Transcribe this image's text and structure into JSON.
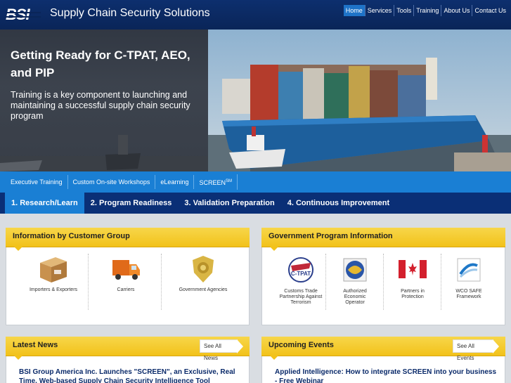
{
  "header": {
    "logo": "BSI",
    "title": "Supply Chain Security Solutions",
    "nav": [
      {
        "label": "Home",
        "active": true
      },
      {
        "label": "Services"
      },
      {
        "label": "Tools"
      },
      {
        "label": "Training"
      },
      {
        "label": "About Us"
      },
      {
        "label": "Contact Us"
      }
    ]
  },
  "hero": {
    "title": "Getting Ready for C-TPAT, AEO, and PIP",
    "subtitle": "Training is a key component to launching and maintaining a successful supply chain security program"
  },
  "program_nav": {
    "items": [
      "Executive Training",
      "Custom On-site Workshops",
      "eLearning",
      "SCREEN"
    ],
    "screen_mark": "SM"
  },
  "steps": [
    {
      "label": "1. Research/Learn",
      "active": true
    },
    {
      "label": "2. Program Readiness"
    },
    {
      "label": "3. Validation Preparation"
    },
    {
      "label": "4. Continuous Improvement"
    }
  ],
  "customer_group": {
    "title": "Information by Customer Group",
    "items": [
      {
        "label": "Importers & Exporters",
        "icon": "package-box-icon"
      },
      {
        "label": "Carriers",
        "icon": "truck-icon"
      },
      {
        "label": "Government Agencies",
        "icon": "badge-icon"
      }
    ]
  },
  "gov_programs": {
    "title": "Government Program Information",
    "items": [
      {
        "label": "Customs Trade Partnership Against Terrorism",
        "lines": [
          "Customs Trade",
          "Partnership Against",
          "Terrorism"
        ],
        "icon": "ctpat-icon"
      },
      {
        "label": "Authorized Economic Operator",
        "lines": [
          "Authorized",
          "Economic",
          "Operator"
        ],
        "icon": "aeo-icon"
      },
      {
        "label": "Partners in Protection",
        "lines": [
          "Partners in",
          "Protection"
        ],
        "icon": "canada-flag-icon"
      },
      {
        "label": "WCO SAFE Framework",
        "lines": [
          "WCO SAFE",
          "Framework"
        ],
        "icon": "wco-icon"
      }
    ]
  },
  "news": {
    "title": "Latest News",
    "see_all": "See All News",
    "headline": "BSI Group America Inc. Launches \"SCREEN\", an Exclusive, Real Time, Web-based Supply Chain Security Intelligence Tool"
  },
  "events": {
    "title": "Upcoming Events",
    "see_all": "See All Events",
    "headline": "Applied Intelligence: How to integrate SCREEN into your business - Free Webinar"
  },
  "colors": {
    "header": "#0a2558",
    "accent_blue": "#1a7fd4",
    "steps_bg": "#0a2f76",
    "panel_header": "#f2c21a"
  }
}
